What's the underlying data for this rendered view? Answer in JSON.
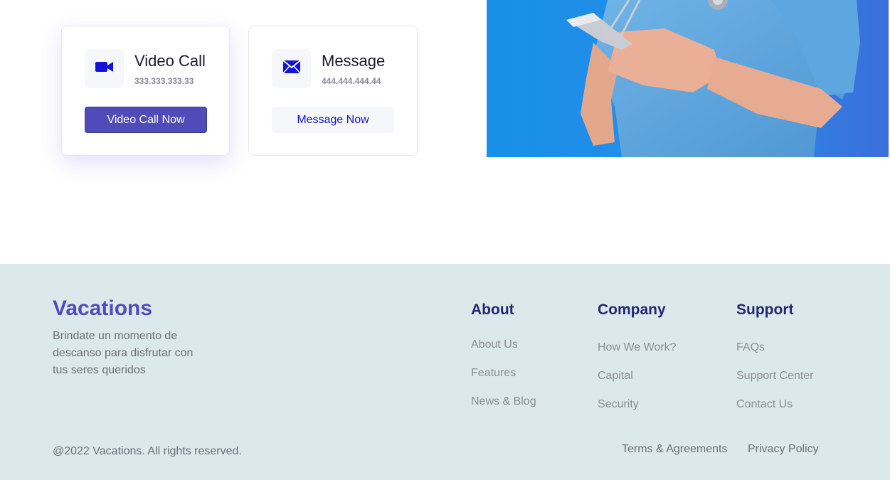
{
  "contact_cards": [
    {
      "title": "Video Call",
      "number": "333.333.333.33",
      "button_label": "Video Call Now",
      "icon": "video-camera-icon"
    },
    {
      "title": "Message",
      "number": "444.444.444.44",
      "button_label": "Message Now",
      "icon": "envelope-icon"
    }
  ],
  "hero": {
    "image": "doctor-with-phone-image"
  },
  "footer": {
    "brand": "Vacations",
    "tagline": "Brindate un momento de descanso para disfrutar con tus seres queridos",
    "columns": [
      {
        "title": "About",
        "links": [
          "About Us",
          "Features",
          "News & Blog"
        ]
      },
      {
        "title": "Company",
        "links": [
          "How We Work?",
          "Capital",
          "Security"
        ]
      },
      {
        "title": "Support",
        "links": [
          "FAQs",
          "Support Center",
          "Contact Us"
        ]
      }
    ],
    "copyright": "@2022 Vacations. All rights reserved.",
    "legal_links": [
      "Terms & Agreements",
      "Privacy Policy"
    ]
  },
  "colors": {
    "accent": "#4f4bb8",
    "icon_blue": "#1414d8",
    "footer_bg": "#dbe9ea",
    "heading": "#232872",
    "hero_blue": "#1a8ee6"
  }
}
